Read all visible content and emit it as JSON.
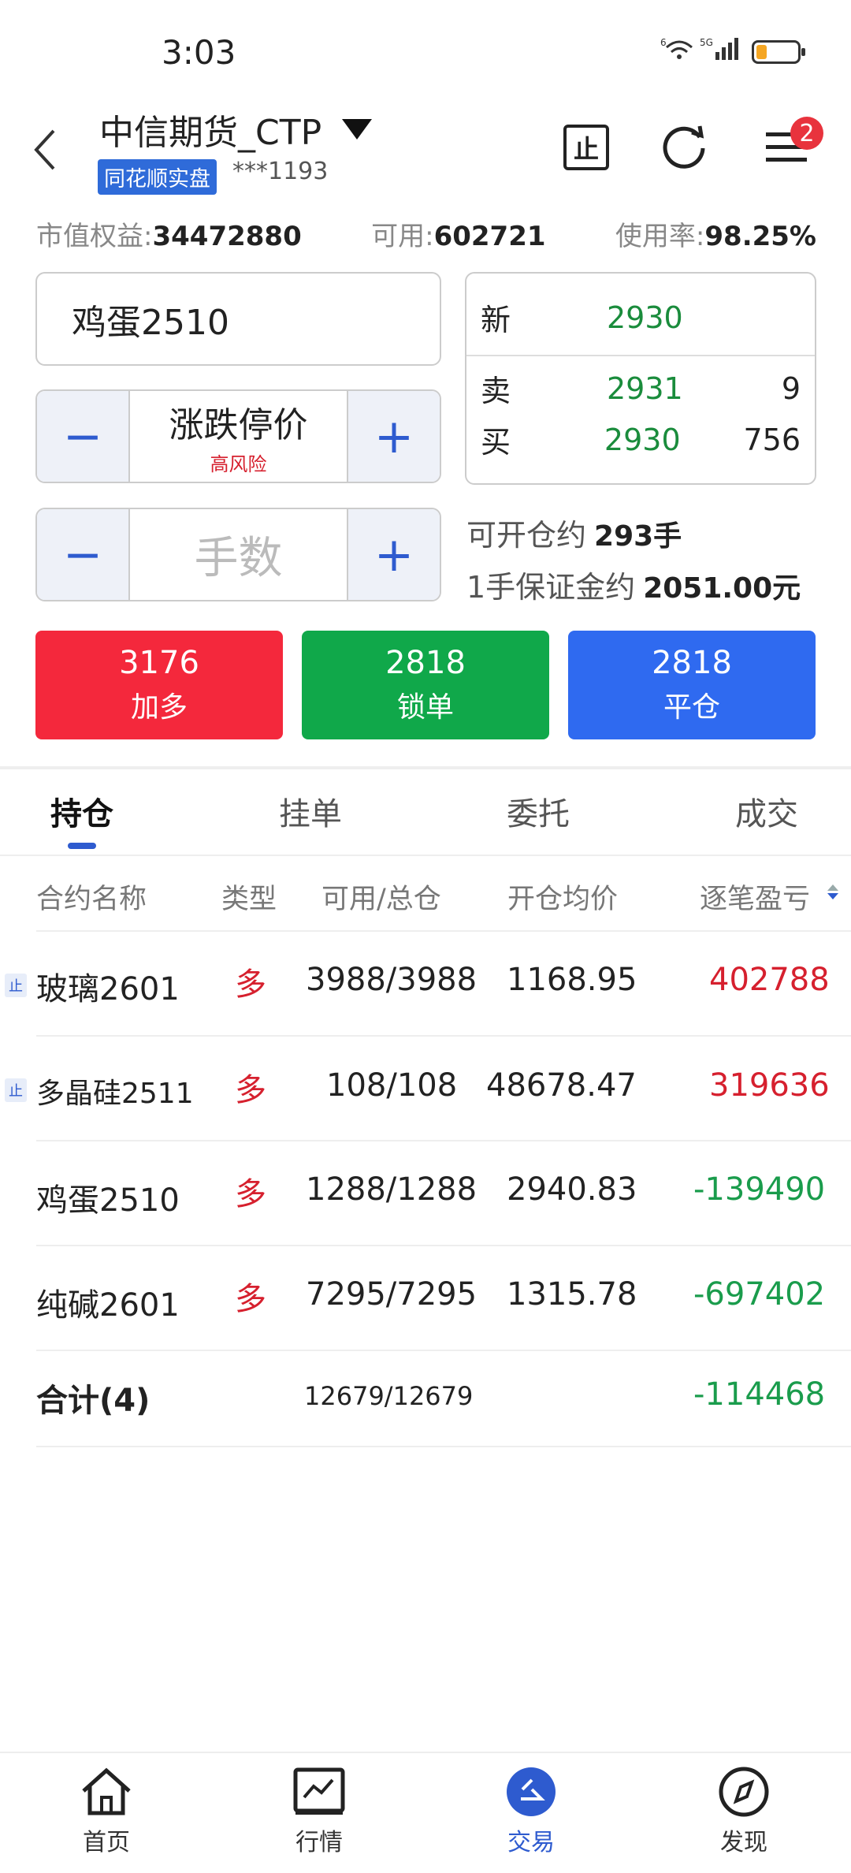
{
  "status_bar": {
    "time": "3:03",
    "signal_text": "5G",
    "wifi_text": "6",
    "battery_level": 0.25
  },
  "header": {
    "account_name": "中信期货_CTP",
    "tag": "同花顺实盘",
    "account_no": "***1193",
    "stop_icon_text": "止",
    "menu_badge": "2"
  },
  "summary": {
    "equity_label": "市值权益:",
    "equity_value": "34472880",
    "available_label": "可用:",
    "available_value": "602721",
    "usage_label": "使用率:",
    "usage_value": "98.25%"
  },
  "order": {
    "contract": "鸡蛋2510",
    "price_type": "涨跌停价",
    "risk_note": "高风险",
    "lots_placeholder": "手数",
    "minus": "−",
    "plus": "+"
  },
  "quote": {
    "last_label": "新",
    "last_price": "2930",
    "ask_label": "卖",
    "ask_price": "2931",
    "ask_vol": "9",
    "bid_label": "买",
    "bid_price": "2930",
    "bid_vol": "756"
  },
  "open_info": {
    "can_open_label": "可开仓约",
    "can_open_value": "293手",
    "margin_label": "1手保证金约",
    "margin_value": "2051.00元"
  },
  "actions": {
    "buy": {
      "num": "3176",
      "label": "加多",
      "color": "#f4283c"
    },
    "lock": {
      "num": "2818",
      "label": "锁单",
      "color": "#10a84a"
    },
    "close": {
      "num": "2818",
      "label": "平仓",
      "color": "#2f6af0"
    }
  },
  "tabs": [
    "持仓",
    "挂单",
    "委托",
    "成交"
  ],
  "table": {
    "headers": [
      "合约名称",
      "类型",
      "可用/总仓",
      "开仓均价",
      "逐笔盈亏"
    ],
    "rows": [
      {
        "stop": "止",
        "name": "玻璃2601",
        "dir": "多",
        "qty": "3988/3988",
        "avg": "1168.95",
        "pnl": "402788"
      },
      {
        "stop": "止",
        "name": "多晶硅2511",
        "dir": "多",
        "qty": "108/108",
        "avg": "48678.47",
        "pnl": "319636"
      },
      {
        "stop": "",
        "name": "鸡蛋2510",
        "dir": "多",
        "qty": "1288/1288",
        "avg": "2940.83",
        "pnl": "-139490"
      },
      {
        "stop": "",
        "name": "纯碱2601",
        "dir": "多",
        "qty": "7295/7295",
        "avg": "1315.78",
        "pnl": "-697402"
      }
    ],
    "total_label": "合计(4)",
    "total_qty": "12679/12679",
    "total_pnl": "-114468"
  },
  "bottom_nav": [
    "首页",
    "行情",
    "交易",
    "发现"
  ],
  "colors": {
    "accent": "#2e5bcf",
    "up": "#d6202e",
    "down": "#1a9c4c"
  }
}
